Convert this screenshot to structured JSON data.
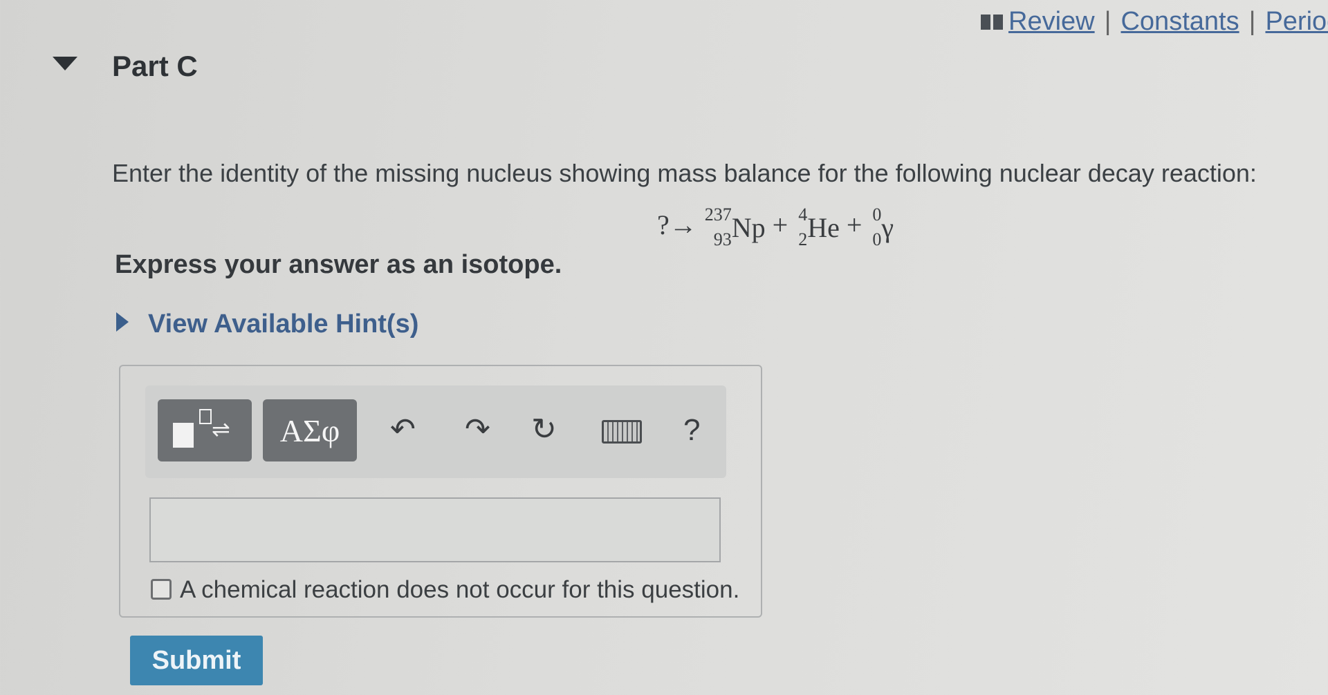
{
  "toplinks": {
    "review": "Review",
    "constants": "Constants",
    "periodic": "Periodic",
    "separator": "|"
  },
  "part": {
    "title": "Part C"
  },
  "question": {
    "text": "Enter the identity of the missing nucleus showing mass balance for the following nuclear decay reaction:",
    "equation": {
      "lhs": "?",
      "arrow": "→",
      "np": {
        "mass": "237",
        "atomic": "93",
        "symbol": "Np"
      },
      "plus": "+",
      "he": {
        "mass": "4",
        "atomic": "2",
        "symbol": "He"
      },
      "gamma": {
        "mass": "0",
        "atomic": "0",
        "symbol": "γ"
      }
    },
    "instruction": "Express your answer as an isotope."
  },
  "hint": {
    "label": "View Available Hint(s)"
  },
  "toolbar": {
    "greek_label": "ΑΣφ",
    "undo_glyph": "↶",
    "redo_glyph": "↷",
    "reset_glyph": "↻",
    "help_label": "?"
  },
  "answer": {
    "value": ""
  },
  "no_reaction": {
    "label": "A chemical reaction does not occur for this question.",
    "checked": false
  },
  "submit": {
    "label": "Submit"
  },
  "colors": {
    "link": "#46699a",
    "submit": "#3d86b0",
    "toolbar_button": "#6d7073"
  }
}
